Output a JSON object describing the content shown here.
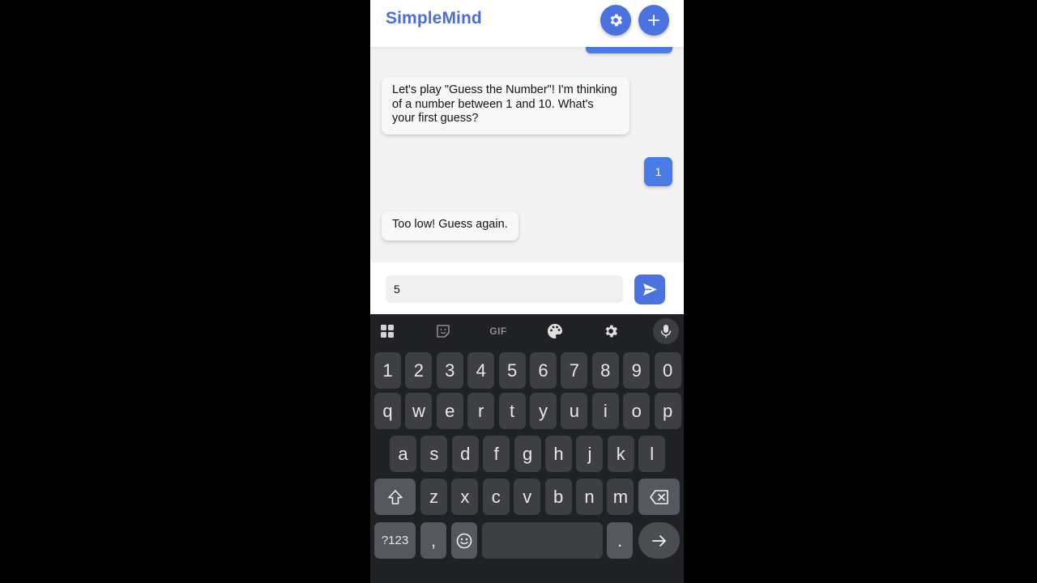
{
  "app": {
    "title": "SimpleMind",
    "accent_color": "#4a73e0"
  },
  "header": {
    "settings_icon": "gear-icon",
    "add_icon": "plus-icon"
  },
  "messages": [
    {
      "role": "bot",
      "text": "Let's play \"Guess the Number\"! I'm thinking of a number between 1 and 10. What's your first guess?"
    },
    {
      "role": "user",
      "text": "1"
    },
    {
      "role": "bot",
      "text": "Too low! Guess again."
    }
  ],
  "composer": {
    "value": "5",
    "send_icon": "send-icon"
  },
  "keyboard": {
    "toolbar": {
      "apps_icon": "grid-icon",
      "sticker_icon": "sticker-icon",
      "gif_label": "GIF",
      "theme_icon": "palette-icon",
      "settings_icon": "gear-icon",
      "mic_icon": "mic-icon"
    },
    "number_row": [
      "1",
      "2",
      "3",
      "4",
      "5",
      "6",
      "7",
      "8",
      "9",
      "0"
    ],
    "row1": [
      "q",
      "w",
      "e",
      "r",
      "t",
      "y",
      "u",
      "i",
      "o",
      "p"
    ],
    "row2": [
      "a",
      "s",
      "d",
      "f",
      "g",
      "h",
      "j",
      "k",
      "l"
    ],
    "row3": [
      "z",
      "x",
      "c",
      "v",
      "b",
      "n",
      "m"
    ],
    "bottom": {
      "symbols_label": "?123",
      "comma_label": ",",
      "emoji_icon": "emoji-icon",
      "period_label": ".",
      "enter_icon": "arrow-right-icon",
      "shift_icon": "shift-icon",
      "backspace_icon": "backspace-icon"
    }
  }
}
